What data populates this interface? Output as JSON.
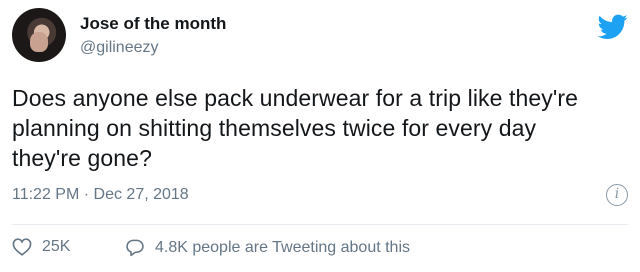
{
  "user": {
    "display_name": "Jose of the month",
    "handle": "@gilineezy"
  },
  "tweet": {
    "text_lines": [
      "Does anyone else pack underwear for a trip like they're",
      "planning on shitting themselves twice for every day",
      "they're gone?"
    ],
    "timestamp": "11:22 PM · Dec 27, 2018"
  },
  "actions": {
    "likes_count": "25K",
    "tweeting_text": "4.8K people are Tweeting about this"
  },
  "icons": {
    "brand": "twitter-bird-icon",
    "info": "info-icon",
    "like": "heart-icon",
    "reply": "speech-bubble-icon"
  },
  "colors": {
    "brand_blue": "#1da1f2",
    "secondary_text": "#657786",
    "primary_text": "#14171a"
  }
}
